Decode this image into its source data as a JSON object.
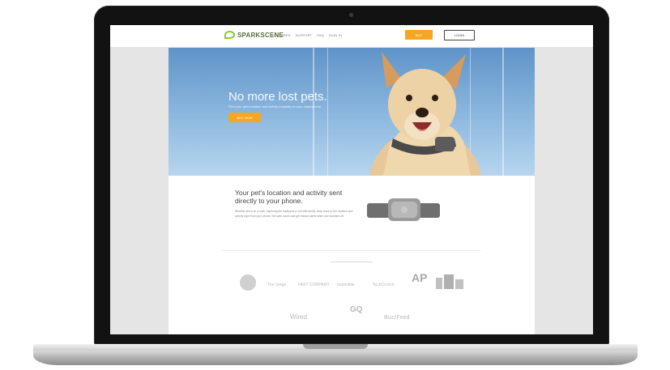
{
  "nav": {
    "logo_text": "SPARKSCENE",
    "links": [
      "FEATURES",
      "SUPPORT",
      "FAQ",
      "SIGN IN"
    ],
    "buy_label": "BUY",
    "login_label": "LOGIN"
  },
  "hero": {
    "title": "No more lost pets.",
    "subtitle": "Find your pets location and activity instantly on your smartphone.",
    "cta": "BUY NOW"
  },
  "section": {
    "title": "Your pet's location and activity sent directly to your phone.",
    "body": "Whether she's on a walk, exploring the backyard or out with family, keep track of her location and activity right from your phone. Set safe zones and get instant alerts when she wanders off."
  },
  "press": {
    "logos": [
      "The Verge",
      "FAST COMPANY",
      "mashable",
      "TechCrunch",
      "AP",
      "Wired",
      "GQ",
      "BuzzFeed"
    ]
  },
  "colors": {
    "accent": "#f5a623",
    "brand": "#8cc63f",
    "sky": "#5f93c8"
  }
}
